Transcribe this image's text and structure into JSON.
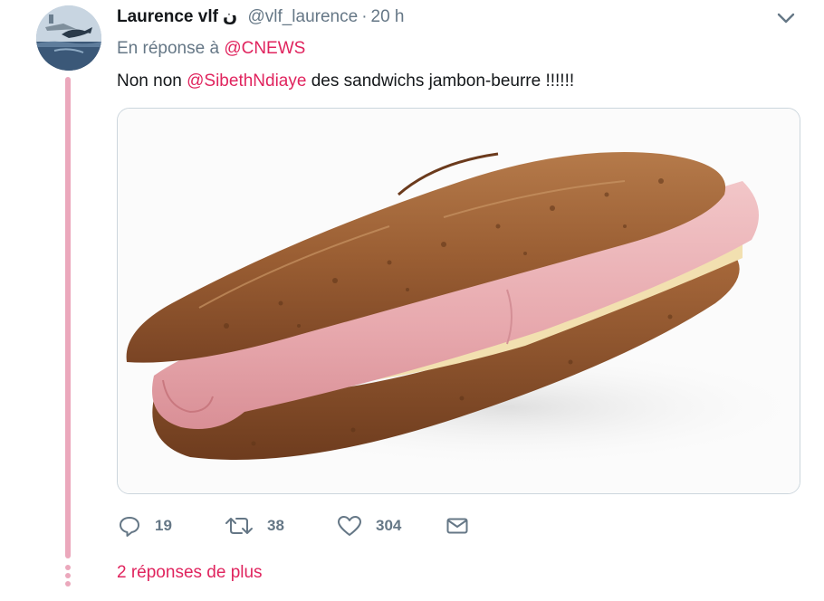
{
  "tweet": {
    "author_name": "Laurence vlf",
    "name_glyph": "ن",
    "handle": "@vlf_laurence",
    "separator": "·",
    "time": "20 h",
    "reply_prefix": "En réponse à",
    "reply_mention": "@CNEWS",
    "text_prefix": "Non non",
    "text_mention": "@SibethNdiaye",
    "text_suffix": "des sandwichs jambon-beurre !!!!!!",
    "media_icon": "ham-baguette-sandwich-photo",
    "stats": {
      "replies": "19",
      "retweets": "38",
      "likes": "304"
    },
    "more_replies": "2 réponses de plus"
  },
  "colors": {
    "mention": "#e0245e",
    "thread_line": "#eba8bc",
    "muted_text": "#657786",
    "primary_text": "#14171a"
  },
  "icons": {
    "caret": "chevron-down-icon",
    "reply": "reply-bubble-icon",
    "retweet": "retweet-icon",
    "like": "heart-icon",
    "dm": "envelope-icon"
  }
}
